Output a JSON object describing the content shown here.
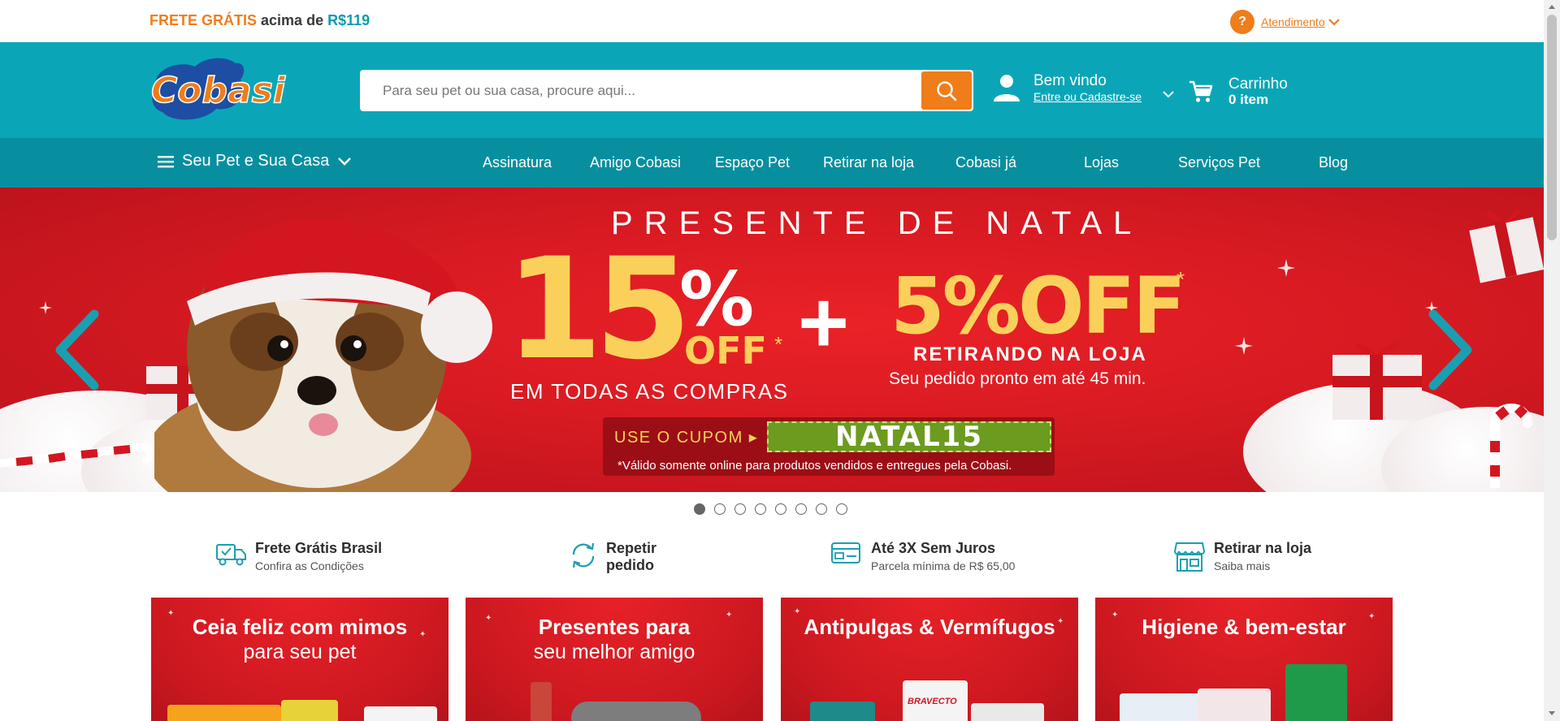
{
  "topbar": {
    "frete_part1": "FRETE GRÁTIS",
    "frete_part2": "acima de",
    "frete_part3": "R$119",
    "help_icon_text": "?",
    "atendimento": "Atendimento"
  },
  "header": {
    "logo_text": "Cobasi",
    "search_placeholder": "Para seu pet ou sua casa, procure aqui...",
    "user_greeting": "Bem vindo",
    "user_link": "Entre ou Cadastre-se",
    "cart_title": "Carrinho",
    "cart_count": "0 item"
  },
  "nav": {
    "menu_label": "Seu Pet e Sua Casa",
    "items": [
      "Assinatura",
      "Amigo Cobasi",
      "Espaço Pet",
      "Retirar na loja",
      "Cobasi já",
      "Lojas",
      "Serviços Pet",
      "Blog"
    ]
  },
  "banner": {
    "title": "PRESENTE DE NATAL",
    "discount_number": "15",
    "discount_percent": "%",
    "discount_off": "OFF",
    "asterisk": "*",
    "discount_sub": "EM TODAS AS COMPRAS",
    "plus": "+",
    "second_discount": "5%OFF",
    "second_sub": "RETIRANDO NA LOJA",
    "second_note": "Seu pedido pronto em até 45 min.",
    "coupon_label": "USE O CUPOM ▸",
    "coupon_code": "NATAL15",
    "coupon_note": "*Válido somente online para produtos vendidos e entregues pela Cobasi.",
    "slide_count": 8,
    "active_slide": 1
  },
  "benefits": [
    {
      "title": "Frete Grátis Brasil",
      "subtitle": "Confira as Condições",
      "icon": "truck-icon"
    },
    {
      "title": "Repetir",
      "subtitle": "pedido",
      "icon": "repeat-icon"
    },
    {
      "title": "Até 3X Sem Juros",
      "subtitle": "Parcela mínima de R$ 65,00",
      "icon": "card-icon"
    },
    {
      "title": "Retirar na loja",
      "subtitle": "Saiba mais",
      "icon": "store-icon"
    }
  ],
  "cards": [
    {
      "title": "Ceia feliz com mimos",
      "subtitle": "para seu pet"
    },
    {
      "title": "Presentes para",
      "subtitle": "seu melhor amigo"
    },
    {
      "title": "Antipulgas & Vermífugos",
      "subtitle": "",
      "brand": "BRAVECTO"
    },
    {
      "title": "Higiene & bem-estar",
      "subtitle": ""
    }
  ],
  "colors": {
    "brand_teal": "#0aa6b7",
    "nav_teal": "#078fa0",
    "brand_orange": "#ef7d1a",
    "banner_red": "#d81a22",
    "coupon_green": "#6b9b1f",
    "discount_yellow": "#fbd05a"
  }
}
